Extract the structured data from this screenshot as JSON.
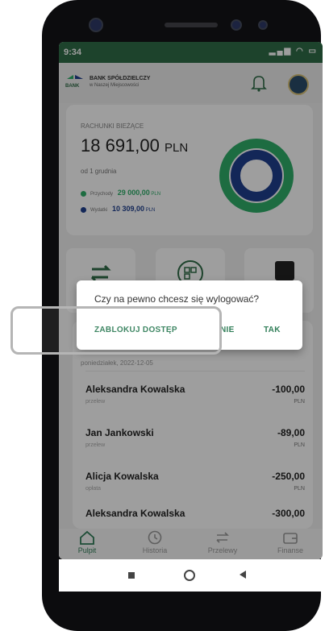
{
  "status": {
    "time": "9:34"
  },
  "header": {
    "bank_name": "BANK SPÓŁDZIELCZY",
    "bank_subtitle": "w Naszej Miejscowości",
    "logo_text": "BANK"
  },
  "account": {
    "label": "RACHUNKI BIEŻĄCE",
    "amount": "18 691,00",
    "currency": "PLN",
    "since": "od 1 grudnia",
    "income_label": "Przychody",
    "income_value": "29 000,00",
    "income_currency": "PLN",
    "expense_label": "Wydatki",
    "expense_value": "10 309,00",
    "expense_currency": "PLN",
    "income_color": "#2fae6a",
    "expense_color": "#1f3f8f",
    "income_share": 0.738
  },
  "dialog": {
    "message": "Czy na pewno chcesz się wylogować?",
    "block_button": "ZABLOKUJ DOSTĘP",
    "no_button": "NIE",
    "yes_button": "TAK"
  },
  "transactions": {
    "date": "poniedziałek, 2022-12-05",
    "items": [
      {
        "name": "Aleksandra Kowalska",
        "type": "przelew",
        "amount": "-100,00",
        "currency": "PLN"
      },
      {
        "name": "Jan Jankowski",
        "type": "przelew",
        "amount": "-89,00",
        "currency": "PLN"
      },
      {
        "name": "Alicja Kowalska",
        "type": "opłata",
        "amount": "-250,00",
        "currency": "PLN"
      },
      {
        "name": "Aleksandra Kowalska",
        "type": "",
        "amount": "-300,00",
        "currency": ""
      }
    ]
  },
  "nav": {
    "items": [
      {
        "label": "Pulpit",
        "icon": "home-icon",
        "active": true
      },
      {
        "label": "Historia",
        "icon": "history-icon",
        "active": false
      },
      {
        "label": "Przelewy",
        "icon": "transfer-icon",
        "active": false
      },
      {
        "label": "Finanse",
        "icon": "wallet-icon",
        "active": false
      }
    ]
  },
  "colors": {
    "brand": "#2f6c47",
    "accent": "#2f7d57"
  }
}
